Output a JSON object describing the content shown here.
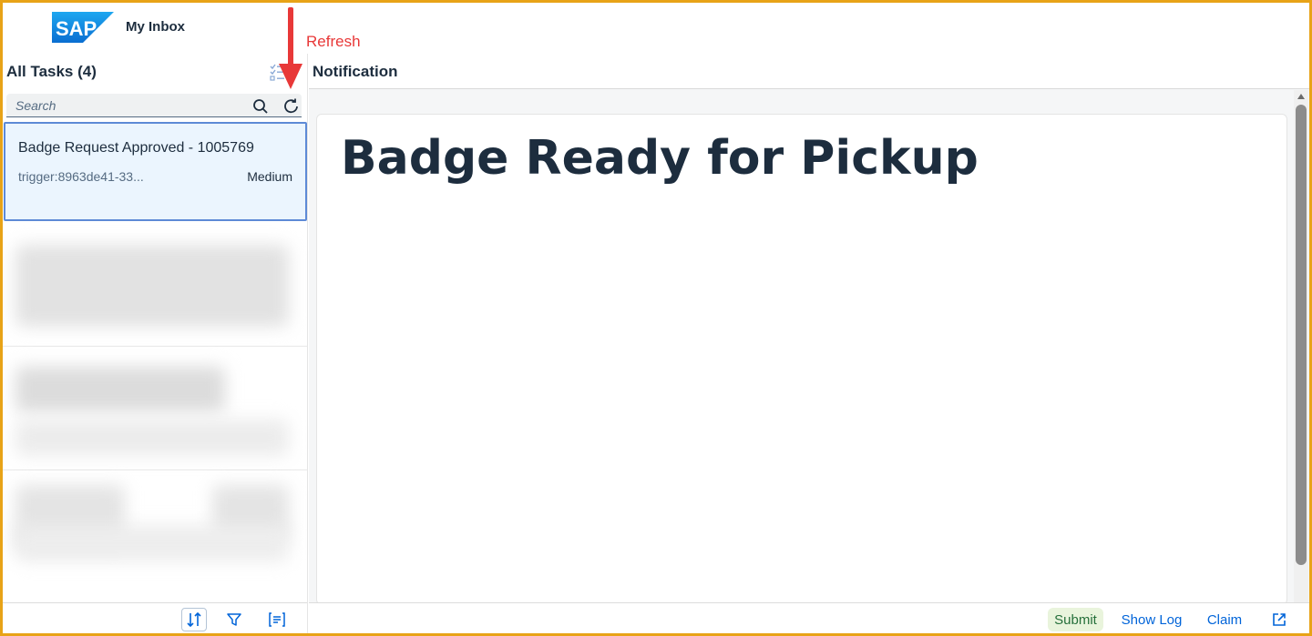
{
  "header": {
    "logo_text": "SAP",
    "app_title": "My Inbox"
  },
  "annotation": {
    "text": "Refresh",
    "color": "#e83838"
  },
  "master": {
    "title": "All Tasks (4)",
    "search_placeholder": "Search",
    "selected_task": {
      "title": "Badge Request Approved - 1005769",
      "subtitle": "trigger:8963de41-33...",
      "priority": "Medium"
    },
    "footer": {
      "sort_icon": "sort-icon",
      "filter_icon": "filter-icon",
      "group_icon": "group-icon"
    }
  },
  "detail": {
    "title": "Notification",
    "heading": "Badge Ready for Pickup",
    "footer": {
      "submit_label": "Submit",
      "show_log_label": "Show Log",
      "claim_label": "Claim",
      "open_icon": "open-in-new-window-icon"
    }
  },
  "colors": {
    "frame_border": "#e8a317",
    "accent": "#0064d9",
    "selected_bg": "#ebf5fe",
    "selected_border": "#5d8ad6",
    "submit_bg": "#e9f4dc"
  }
}
